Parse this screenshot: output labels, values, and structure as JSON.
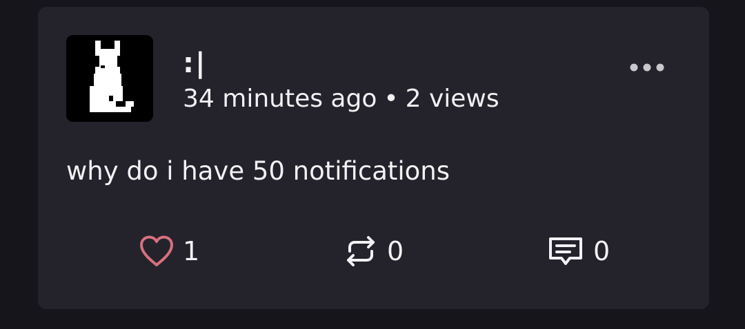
{
  "post": {
    "username": ":|",
    "time_ago": "34 minutes ago",
    "separator": "•",
    "views": "2 views",
    "body": "why do i have 50 notifications",
    "avatar_icon": "pixel-cat-silhouette",
    "menu_icon": "more-dots-icon"
  },
  "actions": {
    "like": {
      "icon": "heart-icon",
      "count": "1",
      "color": "#d8707e"
    },
    "repost": {
      "icon": "repost-icon",
      "count": "0",
      "color": "#f2f2f4"
    },
    "comment": {
      "icon": "comment-icon",
      "count": "0",
      "color": "#f2f2f4"
    }
  },
  "colors": {
    "page_background": "#16151c",
    "card_background": "#24232c",
    "text": "#f2f2f4",
    "menu_dots": "#c8c8cc"
  }
}
